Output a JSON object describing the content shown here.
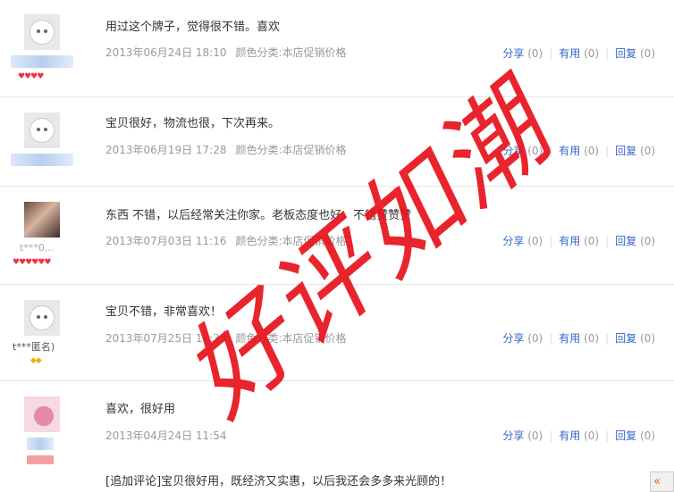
{
  "reviews": [
    {
      "content": "用过这个牌子，觉得很不错。喜欢",
      "date": "2013年06月24日 18:10",
      "sku": "颜色分类:本店促销价格",
      "share": "分享",
      "share_count": "(0)",
      "useful": "有用",
      "useful_count": "(0)",
      "reply": "回复",
      "reply_count": "(0)"
    },
    {
      "content": "宝贝很好，物流也很，下次再来。",
      "date": "2013年06月19日 17:28",
      "sku": "颜色分类:本店促销价格",
      "share": "分享",
      "share_count": "(0)",
      "useful": "有用",
      "useful_count": "(0)",
      "reply": "回复",
      "reply_count": "(0)"
    },
    {
      "content": "东西 不错，以后经常关注你家。老板态度也好，不错赞赞赞",
      "date": "2013年07月03日 11:16",
      "sku": "颜色分类:本店促销价格",
      "share": "分享",
      "share_count": "(0)",
      "useful": "有用",
      "useful_count": "(0)",
      "reply": "回复",
      "reply_count": "(0)",
      "username": "t***0..."
    },
    {
      "content": "宝贝不错，非常喜欢！",
      "date": "2013年07月25日 17:33",
      "sku": "颜色分类:本店促销价格",
      "share": "分享",
      "share_count": "(0)",
      "useful": "有用",
      "useful_count": "(0)",
      "reply": "回复",
      "reply_count": "(0)",
      "username": "t***匿名)"
    },
    {
      "content": "喜欢，很好用",
      "date": "2013年04月24日 11:54",
      "sku": "",
      "share": "分享",
      "share_count": "(0)",
      "useful": "有用",
      "useful_count": "(0)",
      "reply": "回复",
      "reply_count": "(0)"
    }
  ],
  "append_review": "[追加评论]宝贝很好用，既经济又实惠，以后我还会多多来光顾的！",
  "watermark_text": "好评如潮",
  "float_button": "«",
  "colors": {
    "link": "#3366cc",
    "watermark": "#e8121b",
    "divider": "#e6e6e6"
  }
}
